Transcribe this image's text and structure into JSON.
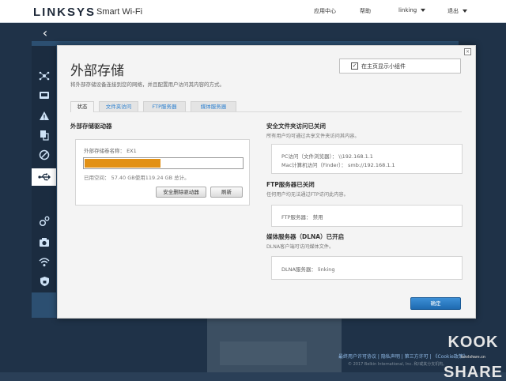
{
  "header": {
    "brand": "LINKSYS",
    "product": "Smart Wi-Fi",
    "nav": [
      "应用中心",
      "帮助",
      "linking",
      "退出"
    ]
  },
  "sidebar": {
    "icons": [
      "network-map-icon",
      "devices-icon",
      "alert-icon",
      "storage-share-icon",
      "parental-icon",
      "usb-icon",
      "connectivity-icon",
      "diagnostics-icon",
      "wireless-icon",
      "security-icon"
    ],
    "active": "usb-icon"
  },
  "modal": {
    "title": "外部存储",
    "subtitle": "将外部存储设备连接到您的网络，并且配置用户访问其内容的方式。",
    "show_home_label": "在主页显示小组件",
    "show_home_checked": true,
    "close": "×",
    "tabs": [
      "状态",
      "文件夹访问",
      "FTP服务器",
      "媒体服务器"
    ],
    "active_tab": 0,
    "left": {
      "title": "外部存储驱动器",
      "drive_label": "外部存储卷名称：  EX1",
      "used_fraction": 0.48,
      "used_text": "已用空间：  57.40 GB使用119.24 GB 总计。",
      "eject_button": "安全删除驱动器",
      "refresh_button": "刷新"
    },
    "right": {
      "secure": {
        "title": "安全文件夹访问已关闭",
        "desc": "所有用户均可通过共享文件夹访问其内容。",
        "pc": "PC访问（文件浏览器）：  \\\\192.168.1.1",
        "mac": "Mac计算机访问（Finder）：  smb://192.168.1.1"
      },
      "ftp": {
        "title": "FTP服务器已关闭",
        "desc": "任何用户均无法通过FTP访问此内容。",
        "line": "FTP服务器：  禁用"
      },
      "dlna": {
        "title": "媒体服务器（DLNA）已开启",
        "desc": "DLNA客户端可访问媒体文件。",
        "line": "DLNA服务器：  linking"
      }
    },
    "ok_button": "确定"
  },
  "footer": {
    "links": "最终用户许可协议  |  隐私声明  |  第三方许可  |  《Cookie政策》",
    "copyright": "© 2017 Belkin International, Inc. 和/或其分支机构。"
  },
  "watermark": {
    "top": "KOOK",
    "bottom": "SHARE",
    "site": "koolshare.cn"
  }
}
